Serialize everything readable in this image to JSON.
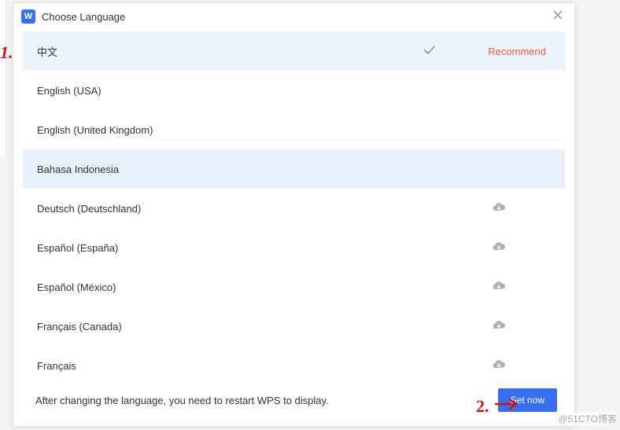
{
  "title": "Choose Language",
  "app_icon_letter": "W",
  "languages": [
    {
      "name": "中文",
      "selected": true,
      "recommended": true,
      "needs_download": false
    },
    {
      "name": "English (USA)",
      "selected": false,
      "recommended": false,
      "needs_download": false
    },
    {
      "name": "English (United Kingdom)",
      "selected": false,
      "recommended": false,
      "needs_download": false
    },
    {
      "name": "Bahasa Indonesia",
      "selected": false,
      "recommended": false,
      "needs_download": false,
      "highlight": true
    },
    {
      "name": "Deutsch (Deutschland)",
      "selected": false,
      "recommended": false,
      "needs_download": true
    },
    {
      "name": "Español (España)",
      "selected": false,
      "recommended": false,
      "needs_download": true
    },
    {
      "name": "Español (México)",
      "selected": false,
      "recommended": false,
      "needs_download": true
    },
    {
      "name": "Français (Canada)",
      "selected": false,
      "recommended": false,
      "needs_download": true
    },
    {
      "name": "Français",
      "selected": false,
      "recommended": false,
      "needs_download": true
    }
  ],
  "recommend_label": "Recommend",
  "footer_text": "After changing the language, you need to restart WPS to display.",
  "set_button": "Set now",
  "annotation1": "1.",
  "annotation2": "2.",
  "watermark": "@51CTO博客"
}
